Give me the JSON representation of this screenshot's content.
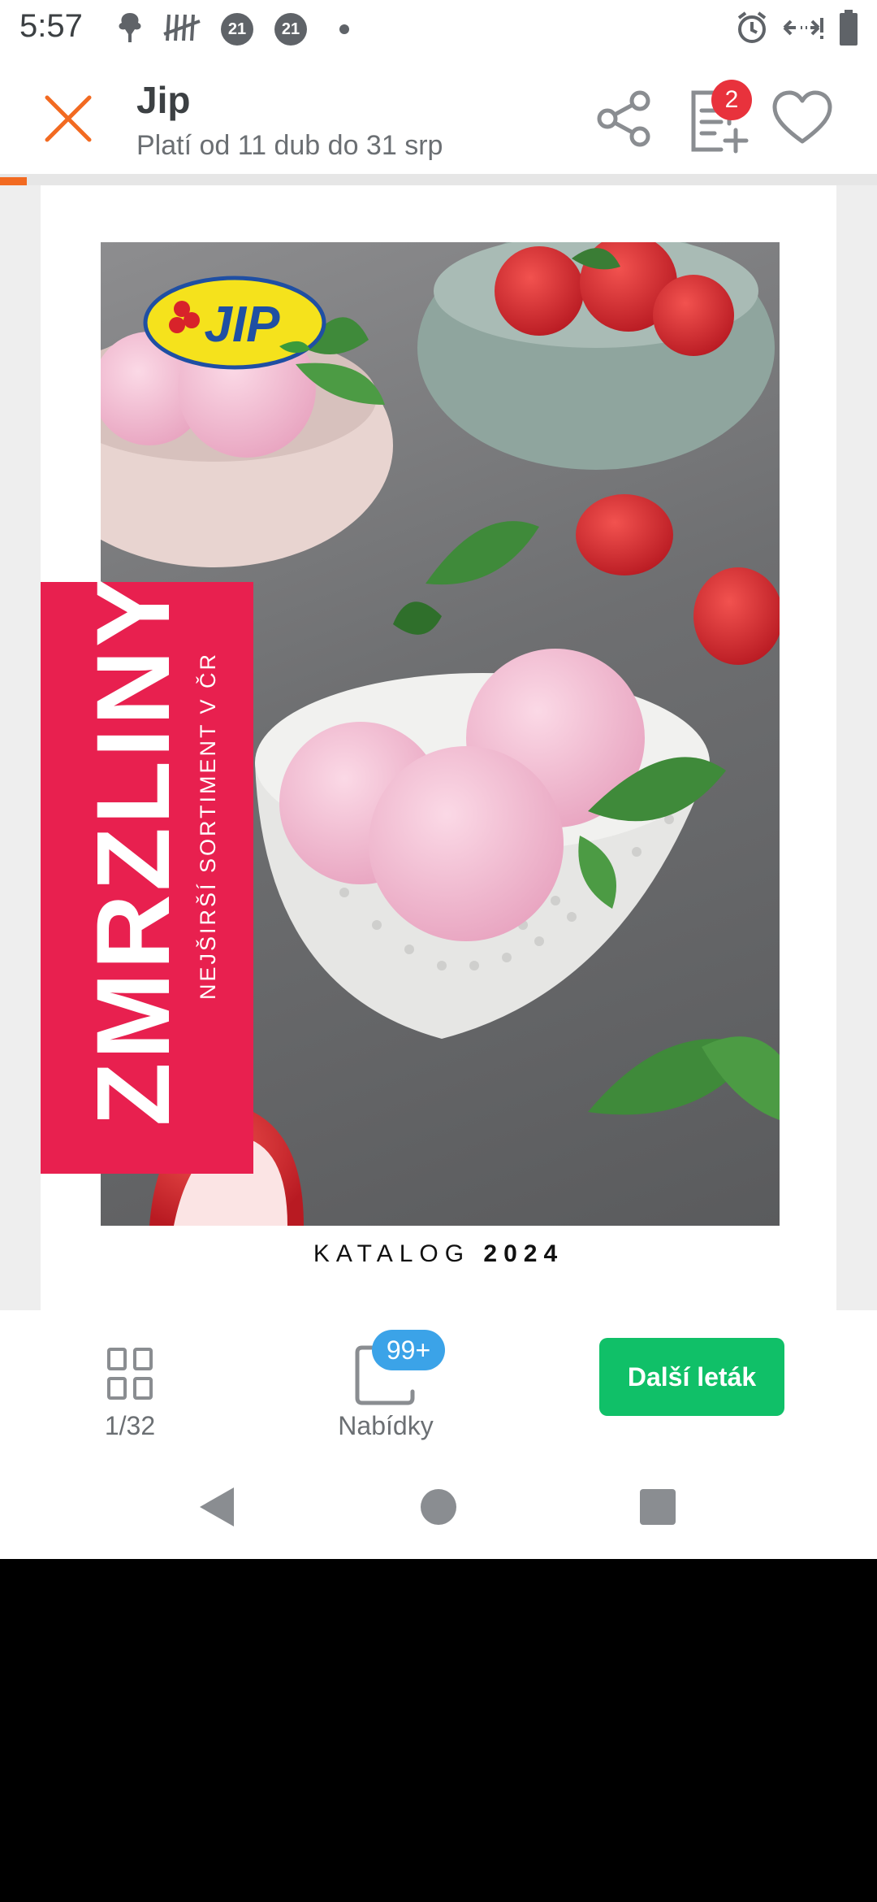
{
  "status_bar": {
    "time": "5:57",
    "badge_1": "21",
    "badge_2": "21"
  },
  "header": {
    "title": "Jip",
    "subtitle": "Platí od 11 dub do 31 srp",
    "list_badge": "2"
  },
  "progress": {
    "fraction": 0.031
  },
  "leaflet": {
    "logo_text": "JIP",
    "banner_title": "ZMRZLINY",
    "banner_subtitle": "NEJŠIRŠÍ SORTIMENT V ČR",
    "catalog_word": "KATALOG",
    "catalog_year": "2024"
  },
  "bottom_bar": {
    "pages_label": "1/32",
    "offers_badge": "99+",
    "offers_label": "Nabídky",
    "next_button": "Další leták"
  },
  "colors": {
    "accent_orange": "#f26a21",
    "banner_red": "#e8204f",
    "next_green": "#10c068",
    "badge_red": "#e8323c",
    "badge_blue": "#3ba3e8",
    "logo_yellow": "#f5e21c",
    "logo_blue": "#1f4fa3"
  },
  "icons": {
    "close": "close-icon",
    "share": "share-icon",
    "shopping_list": "list-add-icon",
    "favorite": "heart-icon",
    "pages": "grid-icon",
    "offers": "tag-icon",
    "scroll_down": "chevron-down-icon"
  }
}
